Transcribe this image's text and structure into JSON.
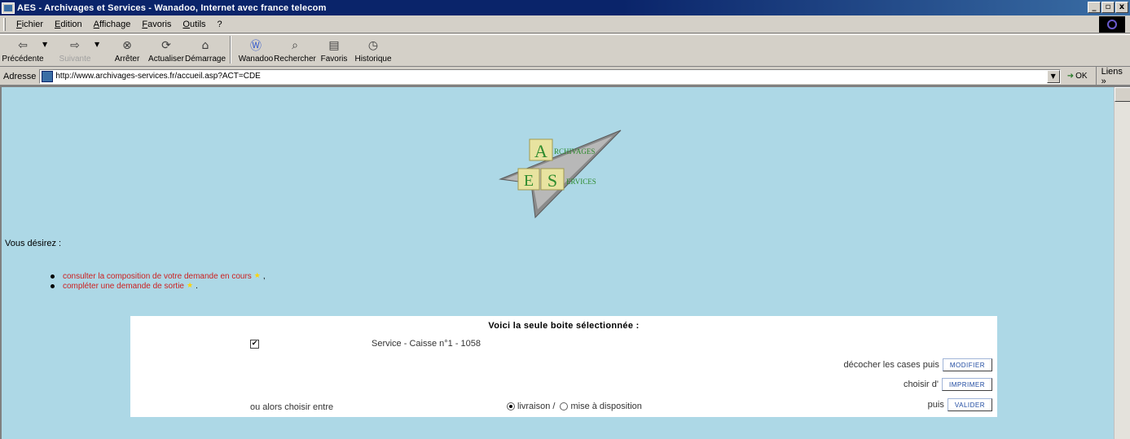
{
  "window": {
    "title": "AES - Archivages et Services - Wanadoo, Internet avec france telecom",
    "controls": [
      "_",
      "▫",
      "x"
    ]
  },
  "menu": [
    "Fichier",
    "Edition",
    "Affichage",
    "Favoris",
    "Outils",
    "?"
  ],
  "toolbar": {
    "back": "Précédente",
    "forward": "Suivante",
    "stop": "Arrêter",
    "refresh": "Actualiser",
    "home": "Démarrage",
    "wanadoo": "Wanadoo",
    "search": "Rechercher",
    "favorites": "Favoris",
    "history": "Historique"
  },
  "address": {
    "label": "Adresse",
    "url": "http://www.archivages-services.fr/accueil.asp?ACT=CDE",
    "go": "OK",
    "links": "Liens »"
  },
  "logo": {
    "letter_a": "A",
    "word_a": "RCHIVAGES",
    "letter_e": "E",
    "letter_s": "S",
    "word_s": "ERVICES"
  },
  "page": {
    "intro": "Vous désirez :",
    "bullets": [
      {
        "text": "consulter la composition de votre demande en cours",
        "star": "★",
        "tail": " ,"
      },
      {
        "text": "compléter une demande de sortie",
        "star": "★",
        "tail": " ."
      }
    ],
    "panel": {
      "title": "Voici la seule boite sélectionnée :",
      "checkbox_mark": "✔",
      "service": "Service  - Caisse n°1 - 1058",
      "row1_label": "décocher les cases puis",
      "row1_button": "MODIFIER",
      "row2_label": "choisir d'",
      "row2_button": "IMPRIMER",
      "choose_label": "ou alors choisir entre",
      "radio1": "livraison /",
      "radio2": "mise à disposition",
      "row3_label": "puis",
      "row3_button": "VALIDER"
    }
  }
}
